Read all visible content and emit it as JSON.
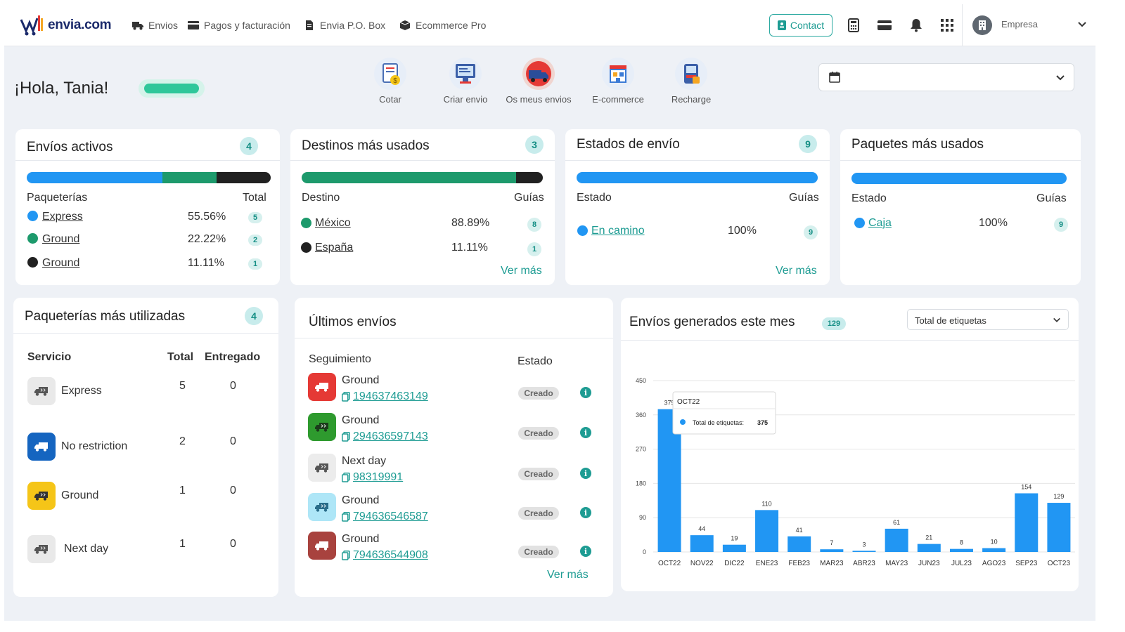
{
  "nav": {
    "logo": "envia.com",
    "items": [
      {
        "label": "Envios",
        "icon": "truck-icon"
      },
      {
        "label": "Pagos y facturación",
        "icon": "card-icon"
      },
      {
        "label": "Envia P.O. Box",
        "icon": "document-icon"
      },
      {
        "label": "Ecommerce Pro",
        "icon": "box-icon"
      }
    ],
    "contact_label": "Contact",
    "company_label": "Empresa"
  },
  "greeting": "¡Hola, Tania!",
  "quick_actions": [
    {
      "label": "Cotar",
      "icon": "quote-icon"
    },
    {
      "label": "Criar envio",
      "icon": "create-shipment-icon"
    },
    {
      "label": "Os meus envios",
      "icon": "my-shipments-icon"
    },
    {
      "label": "E-commerce",
      "icon": "store-icon"
    },
    {
      "label": "Recharge",
      "icon": "recharge-icon"
    }
  ],
  "envios_activos": {
    "title": "Envíos activos",
    "count": "4",
    "col1": "Paqueterías",
    "col2": "Total",
    "segments": [
      {
        "pct": 55.56,
        "color": "#2196f3"
      },
      {
        "pct": 22.22,
        "color": "#1d9a6c"
      },
      {
        "pct": 22.22,
        "color": "#212121"
      }
    ],
    "rows": [
      {
        "name": "Express",
        "pct": "55.56%",
        "count": "5",
        "color": "#2196f3"
      },
      {
        "name": "Ground",
        "pct": "22.22%",
        "count": "2",
        "color": "#1d9a6c"
      },
      {
        "name": "Ground",
        "pct": "11.11%",
        "count": "1",
        "color": "#212121"
      }
    ]
  },
  "destinos": {
    "title": "Destinos más usados",
    "count": "3",
    "col1": "Destino",
    "col2": "Guías",
    "segments": [
      {
        "pct": 88.89,
        "color": "#1d9a6c"
      },
      {
        "pct": 11.11,
        "color": "#212121"
      }
    ],
    "rows": [
      {
        "name": "México",
        "pct": "88.89%",
        "count": "8",
        "color": "#1d9a6c"
      },
      {
        "name": "España",
        "pct": "11.11%",
        "count": "1",
        "color": "#212121"
      }
    ],
    "ver_mas": "Ver más"
  },
  "estados": {
    "title": "Estados de envío",
    "count": "9",
    "col1": "Estado",
    "col2": "Guías",
    "rows": [
      {
        "name": "En camino",
        "pct": "100%",
        "count": "9",
        "color": "#2196f3"
      }
    ],
    "ver_mas": "Ver más"
  },
  "paquetes": {
    "title": "Paquetes más usados",
    "col1": "Estado",
    "col2": "Guías",
    "rows": [
      {
        "name": "Caja",
        "pct": "100%",
        "count": "9",
        "color": "#2196f3"
      }
    ]
  },
  "paqueterias": {
    "title": "Paqueterías más utilizadas",
    "count": "4",
    "col_service": "Servicio",
    "col_total": "Total",
    "col_delivered": "Entregado",
    "rows": [
      {
        "name": "Express",
        "total": "5",
        "delivered": "0",
        "icon_bg": "#e9e9e9",
        "icon_fg": "#555"
      },
      {
        "name": "No restriction",
        "total": "2",
        "delivered": "0",
        "icon_bg": "#1565c0",
        "icon_fg": "#fff"
      },
      {
        "name": "Ground",
        "total": "1",
        "delivered": "0",
        "icon_bg": "#f5c518",
        "icon_fg": "#333"
      },
      {
        "name": "Next day",
        "total": "1",
        "delivered": "0",
        "icon_bg": "#e9e9e9",
        "icon_fg": "#555"
      }
    ]
  },
  "ultimos": {
    "title": "Últimos envíos",
    "col_track": "Seguimiento",
    "col_status": "Estado",
    "rows": [
      {
        "service": "Ground",
        "tracking": "194637463149",
        "status": "Creado",
        "icon_bg": "#e53935",
        "icon_fg": "#fff"
      },
      {
        "service": "Ground",
        "tracking": "294636597143",
        "status": "Creado",
        "icon_bg": "#2e9a2e",
        "icon_fg": "#1b3b1b"
      },
      {
        "service": "Next day",
        "tracking": "98319991",
        "status": "Creado",
        "icon_bg": "#ececec",
        "icon_fg": "#555"
      },
      {
        "service": "Ground",
        "tracking": "794636546587",
        "status": "Creado",
        "icon_bg": "#aee6f7",
        "icon_fg": "#2a6d8a"
      },
      {
        "service": "Ground",
        "tracking": "794636544908",
        "status": "Creado",
        "icon_bg": "#a8423e",
        "icon_fg": "#fff"
      }
    ],
    "ver_mas": "Ver más"
  },
  "generados": {
    "title": "Envíos generados este mes",
    "count": "129",
    "select_value": "Total de etiquetas",
    "tooltip_title": "OCT22",
    "tooltip_label": "Total de etiquetas:",
    "tooltip_value": "375"
  },
  "chart_data": {
    "type": "bar",
    "categories": [
      "OCT22",
      "NOV22",
      "DIC22",
      "ENE23",
      "FEB23",
      "MAR23",
      "ABR23",
      "MAY23",
      "JUN23",
      "JUL23",
      "AGO23",
      "SEP23",
      "OCT23"
    ],
    "series": [
      {
        "name": "Total de etiquetas",
        "values": [
          375,
          44,
          19,
          110,
          41,
          7,
          3,
          61,
          21,
          8,
          10,
          154,
          129
        ],
        "color": "#2196f3"
      }
    ],
    "yticks": [
      0,
      90,
      180,
      270,
      360,
      450
    ],
    "ylim": [
      0,
      450
    ],
    "grid": true
  }
}
